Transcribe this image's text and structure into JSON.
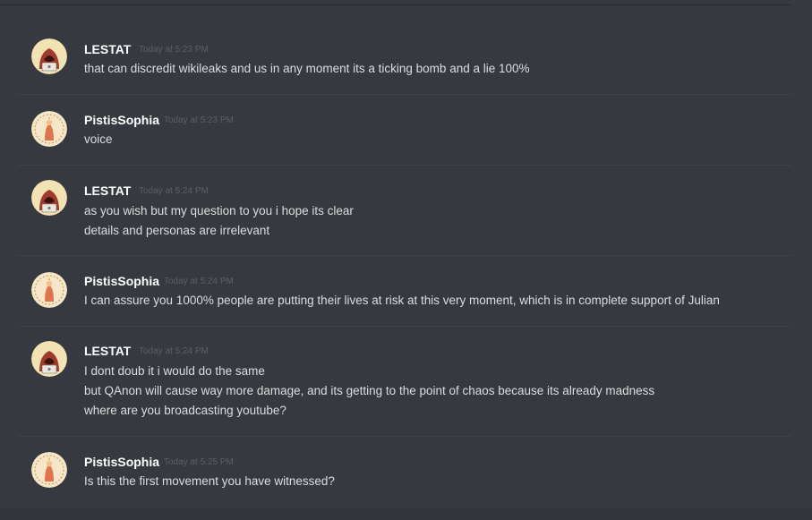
{
  "messages": [
    {
      "author": "LESTAT",
      "timestamp": "Today at 5:23 PM",
      "avatar": "hooded-hacker-icon",
      "lines": [
        "that can discredit wikileaks and us in any moment its a ticking bomb and a lie 100%"
      ]
    },
    {
      "author": "PistisSophia",
      "timestamp": "Today at 5:23 PM",
      "avatar": "sophia-figure-icon",
      "lines": [
        "voice"
      ]
    },
    {
      "author": "LESTAT",
      "timestamp": "Today at 5:24 PM",
      "avatar": "hooded-hacker-icon",
      "lines": [
        "as you wish but my question to you i hope its clear",
        "details and personas are irrelevant"
      ]
    },
    {
      "author": "PistisSophia",
      "timestamp": "Today at 5:24 PM",
      "avatar": "sophia-figure-icon",
      "lines": [
        "I can assure you 1000% people are putting their lives at risk at this very moment, which is in complete support of Julian"
      ]
    },
    {
      "author": "LESTAT",
      "timestamp": "Today at 5:24 PM",
      "avatar": "hooded-hacker-icon",
      "lines": [
        "I dont doub it i would do the same",
        "but QAnon will cause way more damage, and its getting to the point of chaos because its already madness",
        "where are you broadcasting youtube?"
      ]
    },
    {
      "author": "PistisSophia",
      "timestamp": "Today at 5:25 PM",
      "avatar": "sophia-figure-icon",
      "lines": [
        "Is this the first movement you have witnessed?"
      ]
    }
  ],
  "colors": {
    "background": "#36393f",
    "username": "#ffffff",
    "text": "#dcddde",
    "timestamp": "#5c5f66"
  }
}
